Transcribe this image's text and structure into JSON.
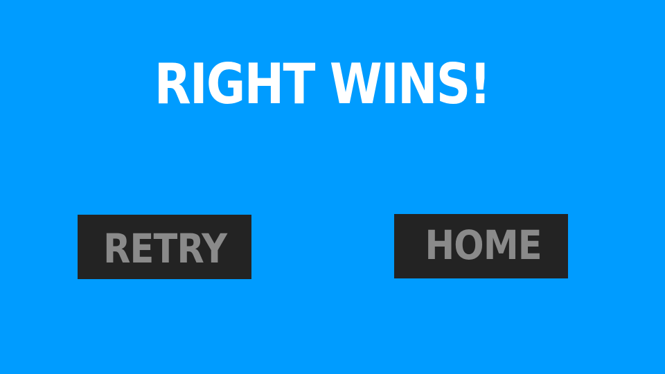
{
  "result": {
    "title": "RIGHT WINS!"
  },
  "buttons": {
    "retry_label": "RETRY",
    "home_label": "HOME"
  },
  "colors": {
    "background": "#009cff",
    "title_text": "#ffffff",
    "button_background": "#232323",
    "button_text": "#8a8a8a"
  }
}
